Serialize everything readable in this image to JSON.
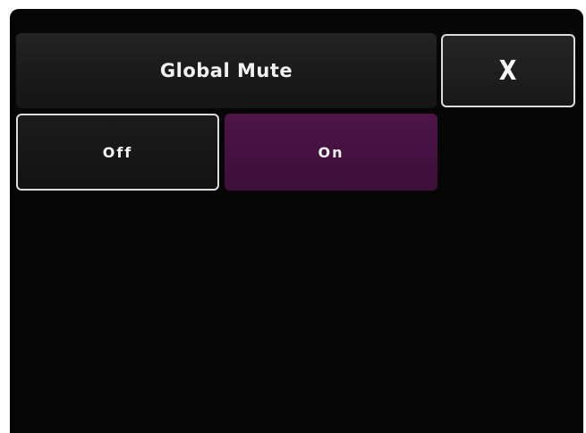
{
  "header": {
    "title": "Global Mute",
    "close_label": "X"
  },
  "mute": {
    "options": [
      {
        "label": "Off",
        "selected": false
      },
      {
        "label": "On",
        "selected": true
      }
    ],
    "selected_color": "#4a1345"
  }
}
